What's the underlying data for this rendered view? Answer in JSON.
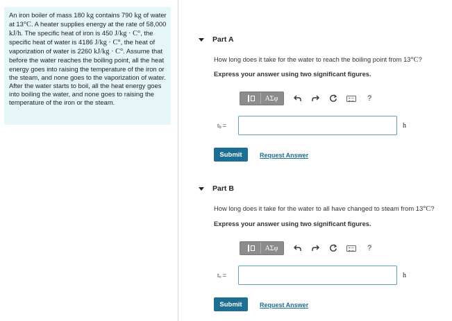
{
  "problem": {
    "p1": "An iron boiler of mass 180",
    "u1": "kg",
    "p2": "contains 790",
    "u2": "kg",
    "p3": "of water at 13",
    "u3": "°C",
    "p4": ". A heater supplies energy at the rate of 58,000",
    "u4": "kJ/h",
    "p5": ". The specific heat of iron is 450",
    "u5": "J/kg · C°",
    "p6": ", the specific heat of water is 4186",
    "u6": "J/kg · C°",
    "p7": ", the heat of vaporization of water is 2260",
    "u7": "kJ/kg · C°",
    "p8": ". Assume that before the water reaches the boiling point, all the heat energy goes into raising the temperature of the iron or the steam, and none goes to the vaporization of water. After the water starts to boil, all the heat energy goes into boiling the water, and none goes to raising the temperature of the iron or the steam."
  },
  "toolbar": {
    "greek_label": "ΑΣφ",
    "icons": [
      "templates-icon",
      "greek-symbols-icon",
      "undo-icon",
      "redo-icon",
      "reset-icon",
      "keyboard-icon",
      "help-icon"
    ]
  },
  "parts": [
    {
      "title": "Part A",
      "question_text": "How long does it take for the water to reach the boiling point from 13",
      "question_unit": "°C",
      "question_end": "?",
      "instruction": "Express your answer using two significant figures.",
      "var_main": "t",
      "var_sub": "b",
      "eq": "=",
      "answer_value": "",
      "unit": "h",
      "submit_label": "Submit",
      "request_label": "Request Answer"
    },
    {
      "title": "Part B",
      "question_text": "How long does it take for the water to all have changed to steam from 13",
      "question_unit": "°C",
      "question_end": "?",
      "instruction": "Express your answer using two significant figures.",
      "var_main": "t",
      "var_sub": "v",
      "eq": "=",
      "answer_value": "",
      "unit": "h",
      "submit_label": "Submit",
      "request_label": "Request Answer"
    }
  ],
  "help_label": "?"
}
